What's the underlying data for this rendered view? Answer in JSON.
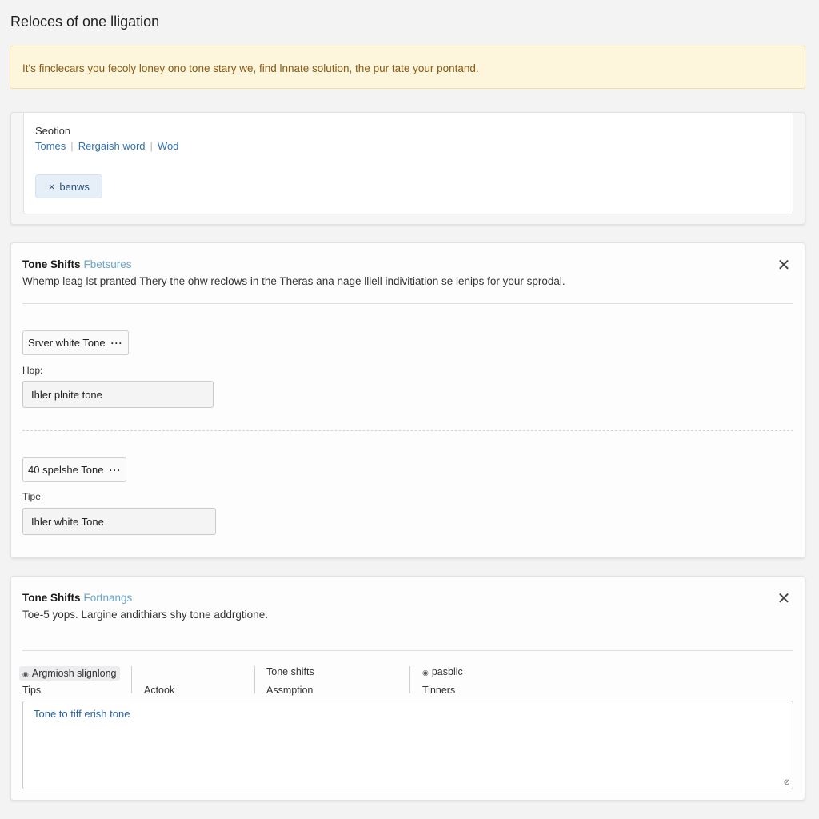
{
  "page": {
    "title": "Reloces of one lligation"
  },
  "alert": {
    "text": "It's finclecars you fecoly loney ono tone stary we, find lnnate solution, the pur tate your pontand."
  },
  "section_card": {
    "label": "Seotion",
    "links": [
      "Tomes",
      "Rergaish word",
      "Wod"
    ],
    "button_label": "benws",
    "button_icon": "person-icon"
  },
  "tone_card_1": {
    "title": "Tone Shifts",
    "subtitle": "Fbetsures",
    "description": "Whemp leag lst pranted Thery the ohw reclows in the Theras ana nage lllell indivitiation se lenips for your sprodal.",
    "close_glyph": "✕",
    "items": [
      {
        "tag_label": "Srver white Tone",
        "tag_dots": "···",
        "field_label": "Hop:",
        "input_value": "Ihler plnite tone"
      },
      {
        "tag_label": "40 spelshe Tone",
        "tag_dots": "···",
        "field_label": "Tipe:",
        "input_value": "Ihler white Tone"
      }
    ]
  },
  "tone_card_2": {
    "title": "Tone Shifts",
    "subtitle": "Fortnangs",
    "description": "Toe-5 yops. Largine andithiars shy tone addrgtione.",
    "close_glyph": "✕",
    "columns": [
      {
        "top": "Argmiosh slignlong",
        "bottom": "Tips",
        "icon": "circle-icon"
      },
      {
        "top": "",
        "bottom": "Actook"
      },
      {
        "top": "Tone shifts",
        "bottom": "Assmption"
      },
      {
        "top": "pasblic",
        "bottom": "Tinners",
        "icon": "circle-icon"
      }
    ],
    "textarea_value": "Tone to tiff erish tone",
    "resize_glyph": "⊘"
  },
  "colors": {
    "background": "#f3f3f4",
    "alert_bg": "#fdf5dc",
    "alert_text": "#8a5a12",
    "link": "#2f72b8",
    "subtitle_accent": "#6aa6c9"
  }
}
